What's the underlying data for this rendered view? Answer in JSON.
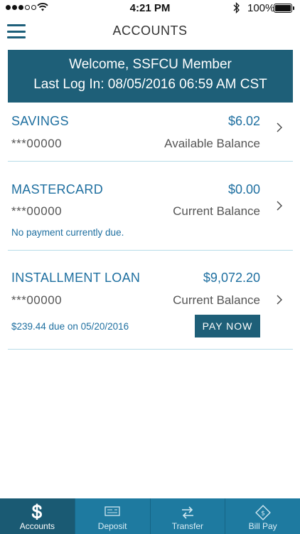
{
  "status_bar": {
    "time": "4:21 PM",
    "battery_percent": "100%"
  },
  "nav": {
    "title": "ACCOUNTS"
  },
  "welcome": {
    "line1": "Welcome, SSFCU Member",
    "line2": "Last Log In: 08/05/2016 06:59 AM CST"
  },
  "accounts": [
    {
      "name": "SAVINGS",
      "amount": "$6.02",
      "number": "***00000",
      "balance_label": "Available Balance"
    },
    {
      "name": "MASTERCARD",
      "amount": "$0.00",
      "number": "***00000",
      "balance_label": "Current Balance",
      "note": "No payment currently due."
    },
    {
      "name": "INSTALLMENT LOAN",
      "amount": "$9,072.20",
      "number": "***00000",
      "balance_label": "Current Balance",
      "note": "$239.44 due on 05/20/2016",
      "button": "PAY NOW"
    }
  ],
  "tabs": [
    {
      "label": "Accounts",
      "icon": "dollar-icon",
      "active": true
    },
    {
      "label": "Deposit",
      "icon": "check-icon",
      "active": false
    },
    {
      "label": "Transfer",
      "icon": "transfer-arrows-icon",
      "active": false
    },
    {
      "label": "Bill Pay",
      "icon": "bill-pay-icon",
      "active": false
    }
  ],
  "colors": {
    "brand_dark": "#1e5f78",
    "brand_link": "#1e6fa0",
    "tab_bar": "#1e7aa0",
    "divider": "#b7dce8"
  }
}
